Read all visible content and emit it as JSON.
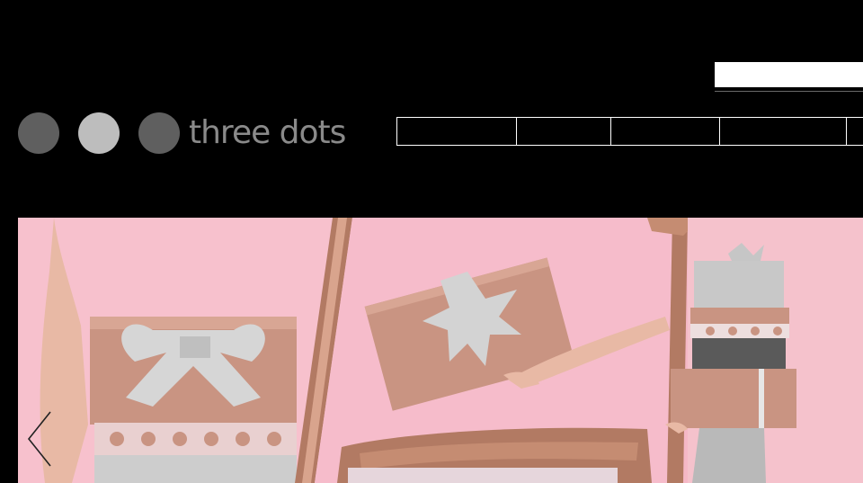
{
  "header": {
    "search": {
      "value": "",
      "placeholder": ""
    },
    "logo": {
      "text": "three dots",
      "dot_colors": [
        "#5f5f5f",
        "#bdbdbd",
        "#5f5f5f"
      ]
    }
  },
  "nav": {
    "items": [
      {
        "label": ""
      },
      {
        "label": ""
      },
      {
        "label": ""
      },
      {
        "label": ""
      },
      {
        "label": ""
      }
    ]
  },
  "hero": {
    "colors": {
      "background": "#f5b8c6",
      "gift_wrap": "#c99482",
      "silver": "#c8c8c8",
      "charcoal": "#5a5a5a",
      "glitter": "#b27a63"
    },
    "controls": {
      "prev_icon": "chevron-left-icon"
    }
  }
}
